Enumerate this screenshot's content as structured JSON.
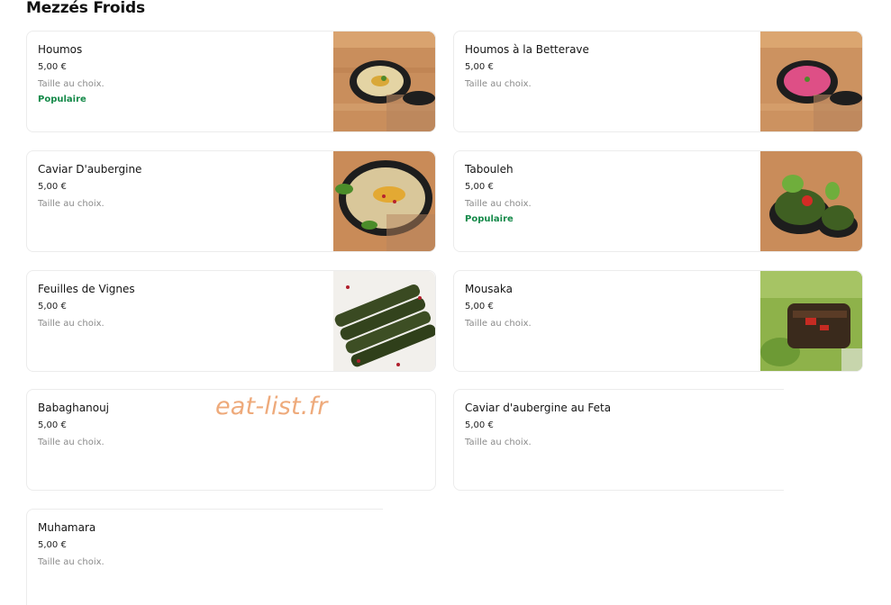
{
  "section": {
    "title": "Mezzés Froids"
  },
  "watermark": "eat-list.fr",
  "items": [
    {
      "name": "Houmos",
      "price": "5,00 €",
      "size": "Taille au choix.",
      "badge": "Populaire",
      "image": "houmos-dish-image"
    },
    {
      "name": "Houmos à la Betterave",
      "price": "5,00 €",
      "size": "Taille au choix.",
      "badge": "",
      "image": "beetroot-houmos-image"
    },
    {
      "name": "Caviar D'aubergine",
      "price": "5,00 €",
      "size": "Taille au choix.",
      "badge": "",
      "image": "eggplant-caviar-image"
    },
    {
      "name": "Tabouleh",
      "price": "5,00 €",
      "size": "Taille au choix.",
      "badge": "Populaire",
      "image": "tabouleh-image"
    },
    {
      "name": "Feuilles de Vignes",
      "price": "5,00 €",
      "size": "Taille au choix.",
      "badge": "",
      "image": "vine-leaves-image"
    },
    {
      "name": "Mousaka",
      "price": "5,00 €",
      "size": "Taille au choix.",
      "badge": "",
      "image": "mousaka-image"
    },
    {
      "name": "Babaghanouj",
      "price": "5,00 €",
      "size": "Taille au choix.",
      "badge": ""
    },
    {
      "name": "Caviar d'aubergine au Feta",
      "price": "5,00 €",
      "size": "Taille au choix.",
      "badge": ""
    },
    {
      "name": "Muhamara",
      "price": "5,00 €",
      "size": "Taille au choix.",
      "badge": ""
    }
  ],
  "colors": {
    "popular_badge": "#168a4a",
    "watermark": "#eeaa7b",
    "card_border": "#ececec"
  }
}
